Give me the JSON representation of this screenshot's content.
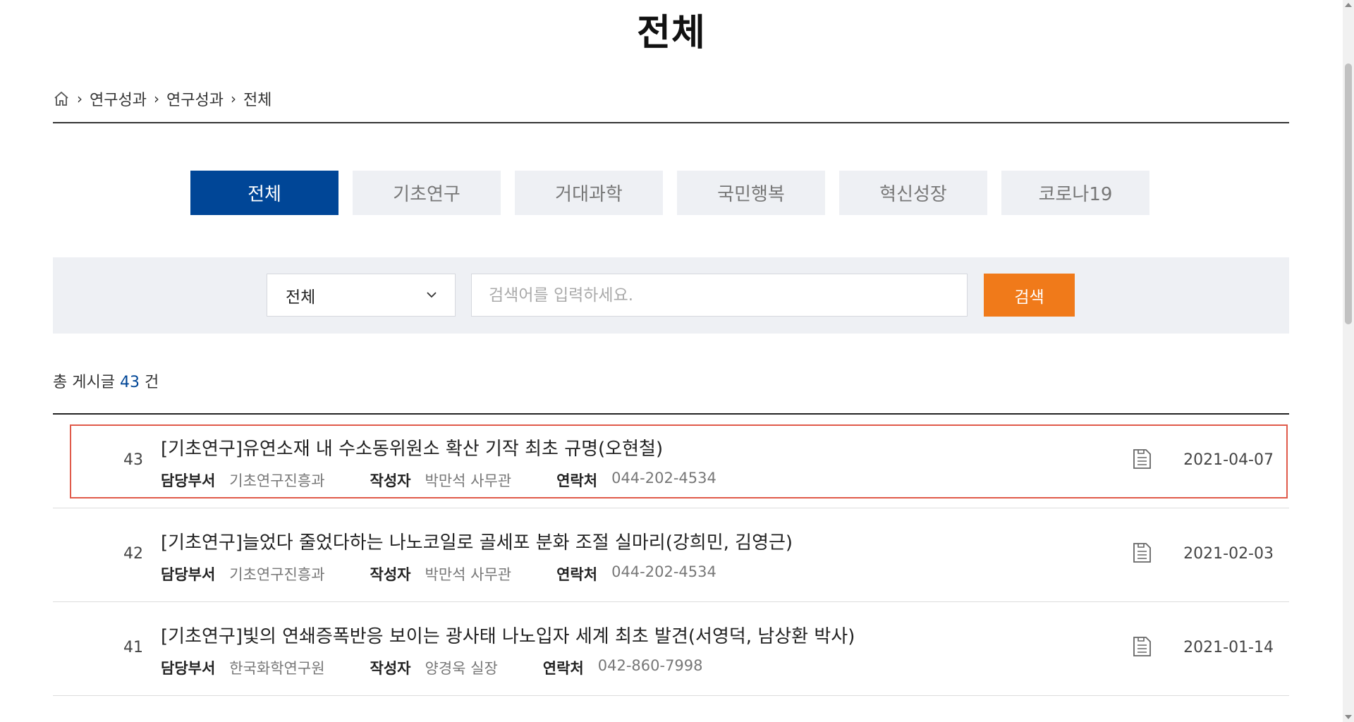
{
  "page": {
    "title": "전체"
  },
  "breadcrumb": {
    "items": [
      "연구성과",
      "연구성과",
      "전체"
    ]
  },
  "tabs": [
    {
      "label": "전체",
      "active": true
    },
    {
      "label": "기초연구",
      "active": false
    },
    {
      "label": "거대과학",
      "active": false
    },
    {
      "label": "국민행복",
      "active": false
    },
    {
      "label": "혁신성장",
      "active": false
    },
    {
      "label": "코로나19",
      "active": false
    }
  ],
  "search": {
    "select_value": "전체",
    "placeholder": "검색어를 입력하세요.",
    "button_label": "검색"
  },
  "total": {
    "prefix": "총 게시글",
    "count": "43",
    "suffix": "건"
  },
  "meta_labels": {
    "dept": "담당부서",
    "author": "작성자",
    "contact": "연락처"
  },
  "posts": [
    {
      "num": "43",
      "title": "[기초연구]유연소재 내 수소동위원소 확산 기작 최초 규명(오현철)",
      "dept": "기초연구진흥과",
      "author": "박만석 사무관",
      "contact": "044-202-4534",
      "date": "2021-04-07"
    },
    {
      "num": "42",
      "title": "[기초연구]늘었다 줄었다하는 나노코일로 골세포 분화 조절 실마리(강희민, 김영근)",
      "dept": "기초연구진흥과",
      "author": "박만석 사무관",
      "contact": "044-202-4534",
      "date": "2021-02-03"
    },
    {
      "num": "41",
      "title": "[기초연구]빛의 연쇄증폭반응 보이는 광사태 나노입자 세계 최초 발견(서영덕, 남상환 박사)",
      "dept": "한국화학연구원",
      "author": "양경욱 실장",
      "contact": "042-860-7998",
      "date": "2021-01-14"
    }
  ],
  "colors": {
    "accent": "#004697",
    "search_button": "#f07a1a",
    "highlight_border": "#e05a4a",
    "panel_bg": "#eef0f4"
  }
}
